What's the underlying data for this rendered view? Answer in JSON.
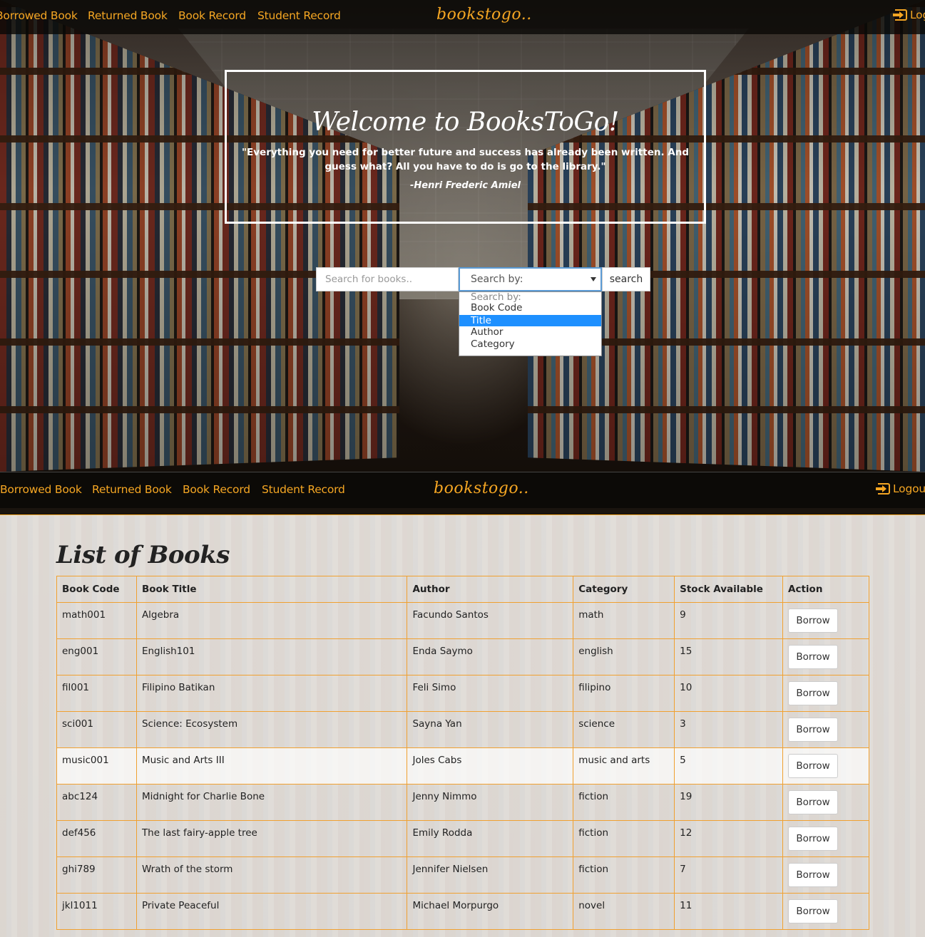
{
  "nav_top": {
    "links": [
      "Borrowed Book",
      "Returned Book",
      "Book Record",
      "Student Record"
    ],
    "logo": "bookstogo..",
    "logout": "Log"
  },
  "nav_sticky": {
    "links": [
      "Borrowed Book",
      "Returned Book",
      "Book Record",
      "Student Record"
    ],
    "logo": "bookstogo..",
    "logout": "Logout"
  },
  "welcome": {
    "title": "Welcome to BooksToGo!",
    "quote": "\"Everything you need for better future and success has already been written. And guess what? All you have to do is go to the library.\"",
    "author": "-Henri Frederic Amiel"
  },
  "search": {
    "placeholder": "Search for books..",
    "select_value": "Search by:",
    "button": "search",
    "options": [
      "Search by:",
      "Book Code",
      "Title",
      "Author",
      "Category"
    ],
    "highlighted_option": "Title"
  },
  "books": {
    "title": "List of Books",
    "headers": [
      "Book Code",
      "Book Title",
      "Author",
      "Category",
      "Stock Available",
      "Action"
    ],
    "action_label": "Borrow",
    "rows": [
      [
        "math001",
        "Algebra",
        "Facundo Santos",
        "math",
        "9"
      ],
      [
        "eng001",
        "English101",
        "Enda Saymo",
        "english",
        "15"
      ],
      [
        "fil001",
        "Filipino Batikan",
        "Feli Simo",
        "filipino",
        "10"
      ],
      [
        "sci001",
        "Science: Ecosystem",
        "Sayna Yan",
        "science",
        "3"
      ],
      [
        "music001",
        "Music and Arts III",
        "Joles Cabs",
        "music and arts",
        "5"
      ],
      [
        "abc124",
        "Midnight for Charlie Bone",
        "Jenny Nimmo",
        "fiction",
        "19"
      ],
      [
        "def456",
        "The last fairy-apple tree",
        "Emily Rodda",
        "fiction",
        "12"
      ],
      [
        "ghi789",
        "Wrath of the storm",
        "Jennifer Nielsen",
        "fiction",
        "7"
      ],
      [
        "jkl1011",
        "Private Peaceful",
        "Michael Morpurgo",
        "novel",
        "11"
      ]
    ]
  },
  "colors": {
    "accent": "#f5a623",
    "table_border": "#f0a030",
    "selected_option": "#1e90ff"
  }
}
